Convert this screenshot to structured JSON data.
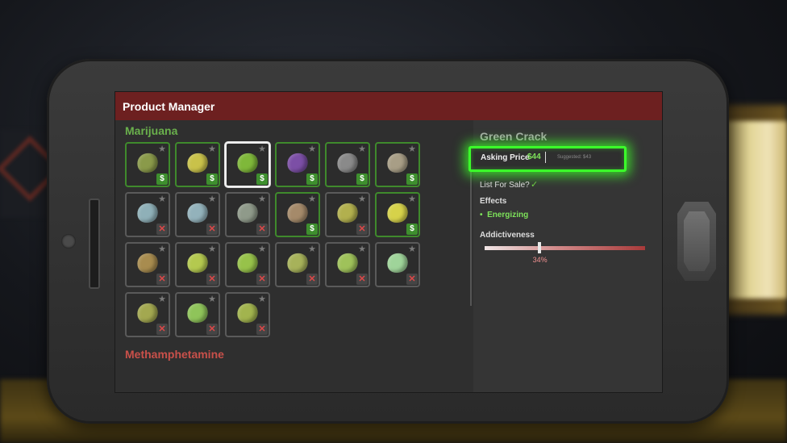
{
  "app": {
    "title": "Product Manager"
  },
  "categories": [
    {
      "name": "Marijuana",
      "color": "#6ab04c",
      "products": [
        {
          "color": "#8a9a4a",
          "status": "sale"
        },
        {
          "color": "#c9c24a",
          "status": "sale"
        },
        {
          "color": "#7fb83a",
          "status": "sale",
          "selected": true
        },
        {
          "color": "#7c4fa6",
          "status": "sale"
        },
        {
          "color": "#8a8a8a",
          "status": "sale"
        },
        {
          "color": "#a89e86",
          "status": "sale"
        },
        {
          "color": "#8fb0b8",
          "status": "no"
        },
        {
          "color": "#93b2bb",
          "status": "no"
        },
        {
          "color": "#8f9a8a",
          "status": "no"
        },
        {
          "color": "#a58a6a",
          "status": "sale"
        },
        {
          "color": "#b2b04e",
          "status": "no"
        },
        {
          "color": "#d6d24a",
          "status": "sale"
        },
        {
          "color": "#a88c4f",
          "status": "no"
        },
        {
          "color": "#b4c94f",
          "status": "no"
        },
        {
          "color": "#97c24a",
          "status": "no"
        },
        {
          "color": "#a7b25a",
          "status": "no"
        },
        {
          "color": "#9fc25a",
          "status": "no"
        },
        {
          "color": "#9fd49a",
          "status": "no"
        },
        {
          "color": "#a3a850",
          "status": "no"
        },
        {
          "color": "#8fc45a",
          "status": "no"
        },
        {
          "color": "#a2b44e",
          "status": "no"
        }
      ]
    },
    {
      "name": "Methamphetamine",
      "color": "#c9504a"
    }
  ],
  "details": {
    "product_name": "Green Crack",
    "asking_price_label": "Asking Price",
    "asking_price_value": "$44",
    "suggested": "Suggested: $43",
    "list_for_sale_label": "List For Sale?",
    "list_for_sale_mark": "✓",
    "effects_heading": "Effects",
    "effects": [
      "Energizing"
    ],
    "addictiveness_heading": "Addictiveness",
    "addictiveness_fraction": 0.34,
    "addictiveness_text": "34%"
  },
  "icons": {
    "star": "★",
    "sale": "$",
    "not_listed": "✕",
    "bullet": "•"
  }
}
